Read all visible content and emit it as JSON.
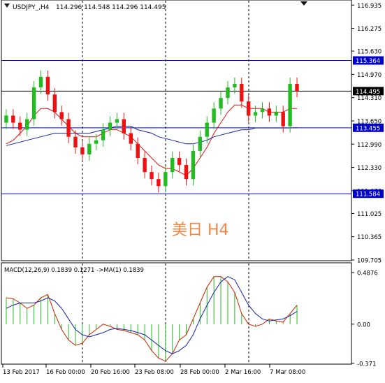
{
  "header": {
    "symbol": "USDJPY_,H4",
    "quote": "114.296 114.548 114.296 114.495"
  },
  "watermark": "美日 H4",
  "colors": {
    "bull": "#22bb22",
    "bear": "#ee1111",
    "ma_fast": "#dd1111",
    "ma_slow": "#1122aa",
    "hline": "#0000dd",
    "macd_hist": "#22bb22",
    "macd_signal": "#cc2200",
    "badge_bg": "#0000cc"
  },
  "icons": {
    "menu": "triangle-down-icon"
  },
  "chart_data": [
    {
      "type": "candlestick",
      "title": "USDJPY_,H4",
      "ylim": [
        109.705,
        117.0
      ],
      "y_ticks": [
        "116.935",
        "116.275",
        "115.630",
        "114.970",
        "114.310",
        "113.650",
        "112.990",
        "112.330",
        "111.670",
        "111.025",
        "110.365",
        "109.705"
      ],
      "x_ticks": [
        "13 Feb 2017",
        "16 Feb 00:00",
        "20 Feb 16:00",
        "23 Feb 08:00",
        "28 Feb 00:00",
        "2 Mar 16:00",
        "7 Mar 08:00"
      ],
      "horizontal_levels": [
        "115.364",
        "113.455",
        "111.584"
      ],
      "current_price": "114.495",
      "series": [
        {
          "name": "close",
          "values": [
            113.8,
            113.6,
            113.4,
            113.7,
            114.6,
            114.9,
            114.4,
            113.9,
            113.7,
            113.2,
            112.9,
            112.7,
            113.0,
            113.1,
            113.4,
            113.6,
            113.7,
            113.3,
            113.0,
            112.6,
            112.2,
            112.0,
            111.8,
            112.2,
            112.6,
            112.4,
            112.0,
            112.8,
            113.2,
            113.6,
            114.0,
            114.3,
            114.6,
            114.7,
            114.2,
            113.8,
            113.9,
            114.0,
            113.8,
            113.9,
            113.5,
            114.7,
            114.5
          ]
        },
        {
          "name": "ma_fast",
          "values": [
            113.0,
            113.1,
            113.3,
            113.5,
            113.8,
            114.0,
            114.0,
            113.9,
            113.7,
            113.5,
            113.3,
            113.2,
            113.2,
            113.2,
            113.3,
            113.4,
            113.4,
            113.3,
            113.2,
            113.0,
            112.8,
            112.6,
            112.4,
            112.3,
            112.3,
            112.2,
            112.1,
            112.3,
            112.6,
            112.9,
            113.3,
            113.6,
            113.9,
            114.1,
            114.1,
            114.0,
            114.0,
            114.0,
            113.9,
            113.9,
            113.9,
            114.0,
            114.0
          ]
        },
        {
          "name": "ma_slow",
          "values": [
            112.95,
            113.0,
            113.05,
            113.1,
            113.15,
            113.2,
            113.25,
            113.3,
            113.3,
            113.3,
            113.3,
            113.3,
            113.3,
            113.35,
            113.4,
            113.45,
            113.5,
            113.5,
            113.5,
            113.4,
            113.35,
            113.3,
            113.2,
            113.15,
            113.1,
            113.05,
            113.0,
            113.0,
            113.05,
            113.1,
            113.2,
            113.25,
            113.3,
            113.35,
            113.4,
            113.4,
            113.45,
            113.45,
            113.45,
            113.45,
            113.45,
            113.45,
            113.46
          ]
        }
      ]
    },
    {
      "type": "bar",
      "title": "MACD(12,26,9) 0.1839 0.1271 ->MA(1) 0.1839",
      "ylim": [
        -0.371,
        0.4876
      ],
      "y_ticks": [
        "0.4876",
        "0.00",
        "-0.371"
      ],
      "series": [
        {
          "name": "macd",
          "values": [
            0.25,
            0.24,
            0.2,
            0.15,
            0.18,
            0.25,
            0.28,
            0.1,
            -0.05,
            -0.15,
            -0.2,
            -0.18,
            -0.1,
            -0.05,
            0.0,
            -0.02,
            -0.05,
            -0.06,
            -0.08,
            -0.1,
            -0.15,
            -0.25,
            -0.32,
            -0.35,
            -0.28,
            -0.15,
            -0.1,
            0.05,
            0.2,
            0.35,
            0.45,
            0.45,
            0.4,
            0.3,
            0.1,
            0.0,
            -0.02,
            0.0,
            0.05,
            0.03,
            0.02,
            0.1,
            0.18
          ]
        },
        {
          "name": "signal",
          "values": [
            0.15,
            0.18,
            0.2,
            0.2,
            0.2,
            0.22,
            0.25,
            0.22,
            0.15,
            0.05,
            -0.05,
            -0.1,
            -0.12,
            -0.1,
            -0.08,
            -0.05,
            -0.04,
            -0.05,
            -0.06,
            -0.08,
            -0.1,
            -0.15,
            -0.2,
            -0.25,
            -0.28,
            -0.25,
            -0.2,
            -0.1,
            0.05,
            0.18,
            0.3,
            0.4,
            0.45,
            0.42,
            0.3,
            0.18,
            0.1,
            0.05,
            0.03,
            0.04,
            0.05,
            0.08,
            0.12
          ]
        }
      ]
    }
  ]
}
